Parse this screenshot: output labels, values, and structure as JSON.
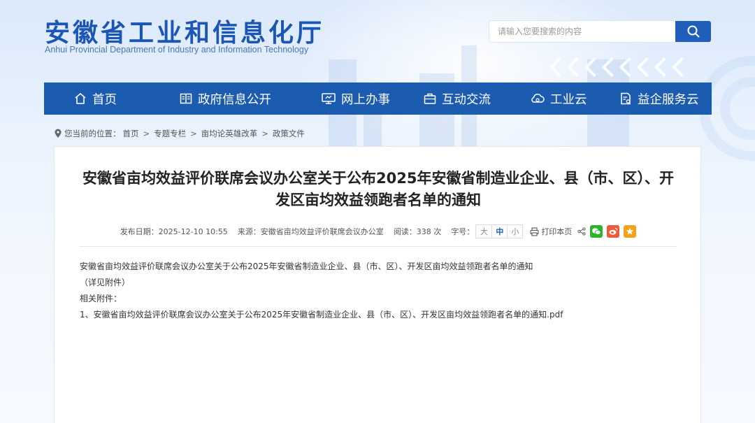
{
  "site": {
    "title_cn": "安徽省工业和信息化厅",
    "title_en": "Anhui Provincial Department of Industry and Information Technology"
  },
  "search": {
    "placeholder": "请输入您要搜索的内容"
  },
  "nav": [
    {
      "label": "首页",
      "icon": "home-icon"
    },
    {
      "label": "政府信息公开",
      "icon": "info-panel-icon"
    },
    {
      "label": "网上办事",
      "icon": "monitor-icon"
    },
    {
      "label": "互动交流",
      "icon": "briefcase-icon"
    },
    {
      "label": "工业云",
      "icon": "cloud-icon"
    },
    {
      "label": "益企服务云",
      "icon": "service-doc-icon"
    }
  ],
  "breadcrumb": {
    "prefix": "您当前的位置：",
    "items": [
      "首页",
      "专题专栏",
      "亩均论英雄改革",
      "政策文件"
    ]
  },
  "article": {
    "title": "安徽省亩均效益评价联席会议办公室关于公布2025年安徽省制造业企业、县（市、区）、开发区亩均效益领跑者名单的通知",
    "meta": {
      "date": "发布日期：2025-12-10 10:55",
      "source": "来源：安徽省亩均效益评价联席会议办公室",
      "views": "阅读：338 次",
      "font_label": "字号：",
      "font_sizes": [
        "大",
        "中",
        "小"
      ],
      "print": "打印本页"
    },
    "body": {
      "line1": "安徽省亩均效益评价联席会议办公室关于公布2025年安徽省制造业企业、县（市、区）、开发区亩均效益领跑者名单的通知",
      "line2": "（详见附件）",
      "attach_label": "相关附件：",
      "attachment": "1、安徽省亩均效益评价联席会议办公室关于公布2025年安徽省制造业企业、县（市、区）、开发区亩均效益领跑者名单的通知.pdf"
    }
  },
  "colors": {
    "brand": "#1b5bb0",
    "wechat": "#2ab52a",
    "weibo": "#f0583a",
    "favorite": "#f3a21d"
  }
}
